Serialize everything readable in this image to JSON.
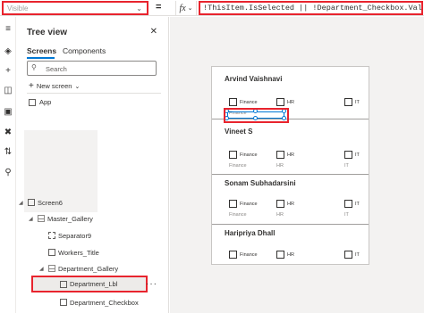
{
  "formula_bar": {
    "property": "Visible",
    "equals": "=",
    "fx": "fx",
    "formula": "!ThisItem.IsSelected || !Department_Checkbox.Value"
  },
  "tree": {
    "title": "Tree view",
    "tabs": [
      "Screens",
      "Components"
    ],
    "search_placeholder": "Search",
    "new_screen": "New screen",
    "app": "App",
    "nodes": {
      "screen": "Screen6",
      "master_gallery": "Master_Gallery",
      "separator": "Separator9",
      "workers_title": "Workers_Title",
      "department_gallery": "Department_Gallery",
      "department_lbl": "Department_Lbl",
      "department_checkbox": "Department_Checkbox"
    }
  },
  "gallery": {
    "workers": [
      {
        "name": "Arvind Vaishnavi"
      },
      {
        "name": "Vineet S"
      },
      {
        "name": "Sonam Subhadarsini"
      },
      {
        "name": "Haripriya Dhall"
      }
    ],
    "departments": [
      "Finance",
      "HR",
      "IT"
    ],
    "selected_label": "Finance"
  },
  "icons": {
    "tree": "layers-icon",
    "insert": "plus-icon",
    "data": "database-icon",
    "media": "media-icon",
    "advanced": "tools-icon",
    "search": "search-icon"
  },
  "colors": {
    "highlight": "#e8242e",
    "accent": "#0078d4"
  }
}
